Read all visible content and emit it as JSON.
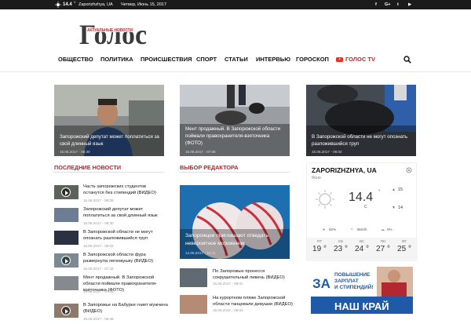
{
  "topbar": {
    "temp": "14.4",
    "deg": "C",
    "location": "Zaporizhzhya, UA",
    "date": "Четвер, Июнь 15, 2017",
    "social": [
      "f",
      "G+",
      "t",
      "▶"
    ]
  },
  "logo": {
    "small": "АКТУАЛЬНЫЕ НОВОСТИ",
    "big": "Голос"
  },
  "nav": [
    "ОБЩЕСТВО",
    "ПОЛИТИКА",
    "ПРОИСШЕСТВИЯ",
    "СПОРТ",
    "СТАТЬИ",
    "ИНТЕРВЬЮ",
    "ГОРОСКОП",
    "ГОЛОС TV"
  ],
  "featured": [
    {
      "title": "Запорожский депутат может поплатиться за свой длинный язык",
      "date": "15.06.2017 - 08:30"
    },
    {
      "title": "Мент продажный. В Запорожской области поймали правохранителя-взяточника (ФОТО)",
      "date": "15.06.2017 - 07:05"
    },
    {
      "title": "В Запорожской области не могут опознать разложившийся труп",
      "date": "15.06.2017 - 06:02"
    }
  ],
  "sections": {
    "latest": "ПОСЛЕДНИЕ НОВОСТИ",
    "editor": "ВЫБОР РЕДАКТОРА"
  },
  "latest": [
    {
      "title": "Часть запорожских студентов останутся без стипендий (ВИДЕО)",
      "date": "15.06.2017 - 09:09"
    },
    {
      "title": "Запорожский депутат может поплатиться за свой длинный язык",
      "date": "15.06.2017 - 08:30"
    },
    {
      "title": "В Запорожской области не могут опознать разложившийся труп",
      "date": "15.06.2017 - 08:02"
    },
    {
      "title": "В Запорожской области фура развернула легковушку (ВИДЕО)",
      "date": "15.06.2017 - 07:32"
    },
    {
      "title": "Мент продажный. В Запорожской области поймали правохранителя-взяточника (ФОТО)",
      "date": "15.06.2017 - 07:05"
    },
    {
      "title": "В Запорожье на Бабурке гниет мужчина (ВИДЕО)",
      "date": "15.06.2017 - 06:49"
    }
  ],
  "editor_main": {
    "title": "Запорожцев приглашают отведать невероятное мороженое",
    "date": "14.06.2017 - 10:31"
  },
  "editor_list": [
    {
      "title": "По Запорожью пронесся сокрушительный ливень (ВИДЕО)",
      "date": "15.06.2017 - 09:01"
    },
    {
      "title": "На курортном пляже Запорожской области танцевали девушки (ВИДЕО)",
      "date": "15.06.2017 - 09:03"
    }
  ],
  "weather": {
    "city": "ZAPORIZHZHYA, UA",
    "condition": "Ясно",
    "temp": "14.4",
    "unit": "C",
    "high": "15",
    "low": "14",
    "humidity": "82%",
    "wind": "5km/h",
    "clouds": "0%",
    "days": [
      {
        "d": "ПТ",
        "t": "19"
      },
      {
        "d": "СБ",
        "t": "23"
      },
      {
        "d": "ВС",
        "t": "24"
      },
      {
        "d": "ПН",
        "t": "27"
      },
      {
        "d": "ВТ",
        "t": "25"
      }
    ]
  },
  "ad": {
    "za": "ЗА",
    "line1": "ПОВЫШЕНИЕ",
    "line2": "ЗАРПЛАТ",
    "line3": "И СТИПЕНДИЙ!",
    "line4": "НАШ КРАЙ"
  }
}
